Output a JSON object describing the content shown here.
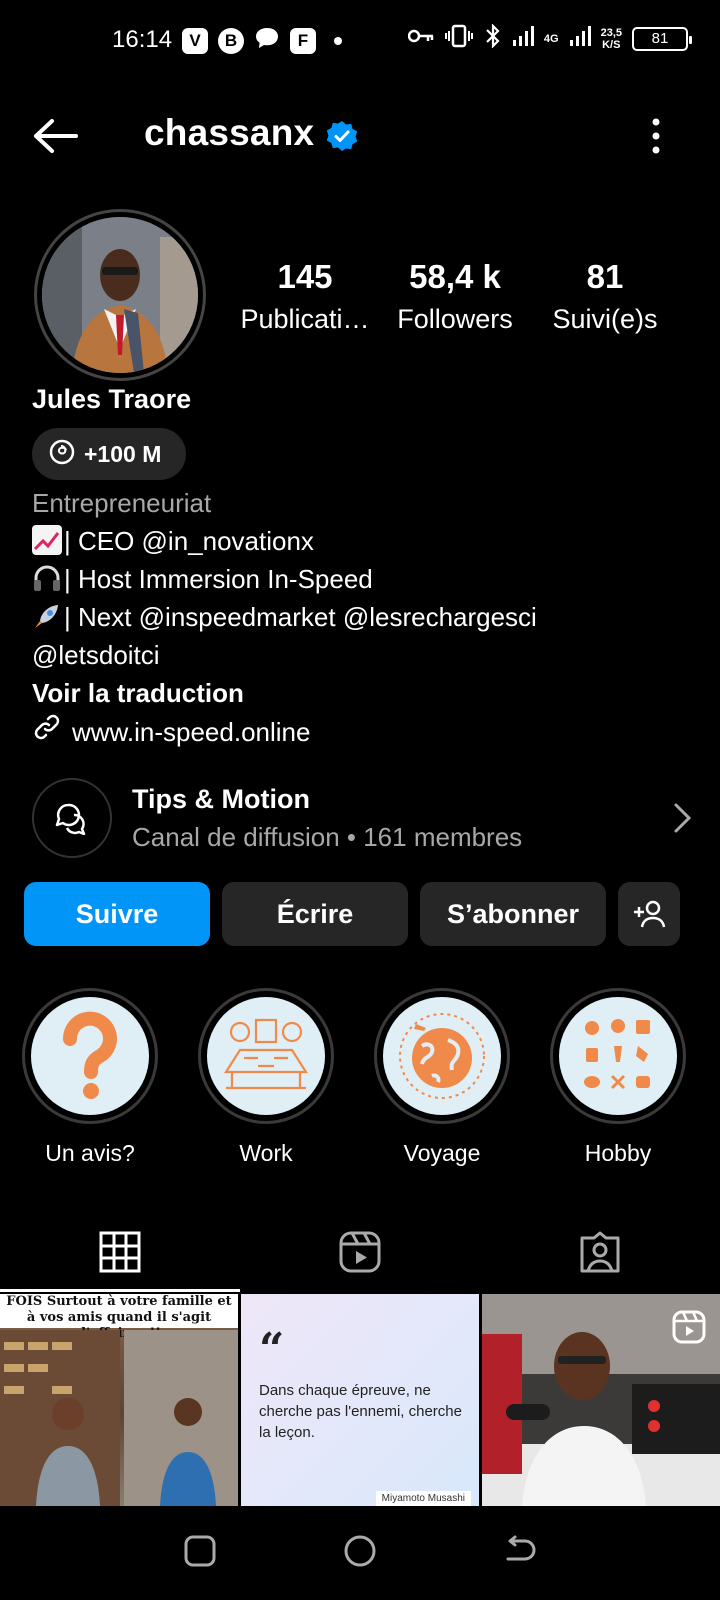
{
  "status_bar": {
    "time": "16:14",
    "apps": [
      "V",
      "B",
      "F"
    ],
    "network": "4G",
    "speed_value": "23,5",
    "speed_unit": "K/S",
    "battery": "81"
  },
  "header": {
    "username": "chassanx",
    "verified_color": "#0095f6"
  },
  "stats": [
    {
      "value": "145",
      "label": "Publicati…"
    },
    {
      "value": "58,4 k",
      "label": "Followers"
    },
    {
      "value": "81",
      "label": "Suivi(e)s"
    }
  ],
  "profile": {
    "full_name": "Jules Traore",
    "threads_badge": "+100 M",
    "category": "Entrepreneuriat",
    "bio_lines": [
      "| CEO @in_novationx",
      "| Host Immersion In-Speed",
      "| Next @inspeedmarket @lesrechargesci",
      "@letsdoitci"
    ],
    "translate": "Voir la traduction",
    "website": "www.in-speed.online"
  },
  "channel": {
    "title": "Tips & Motion",
    "subtitle": "Canal de diffusion • 161 membres"
  },
  "actions": {
    "follow": "Suivre",
    "message": "Écrire",
    "subscribe": "S’abonner"
  },
  "highlights": [
    {
      "label": "Un avis?"
    },
    {
      "label": "Work"
    },
    {
      "label": "Voyage"
    },
    {
      "label": "Hobby"
    }
  ],
  "grid": {
    "post1_caption": "FOIS   Surtout à votre famille et à vos amis quand il s'agit d'affaires !!",
    "post2_quote": "Dans chaque épreuve, ne cherche pas l'ennemi, cherche la leçon.",
    "post2_author": "Miyamoto Musashi"
  },
  "colors": {
    "accent": "#0095f6",
    "button_bg": "#262626",
    "secondary_text": "#a8a8a8",
    "highlight_art": "#f08a4b"
  }
}
